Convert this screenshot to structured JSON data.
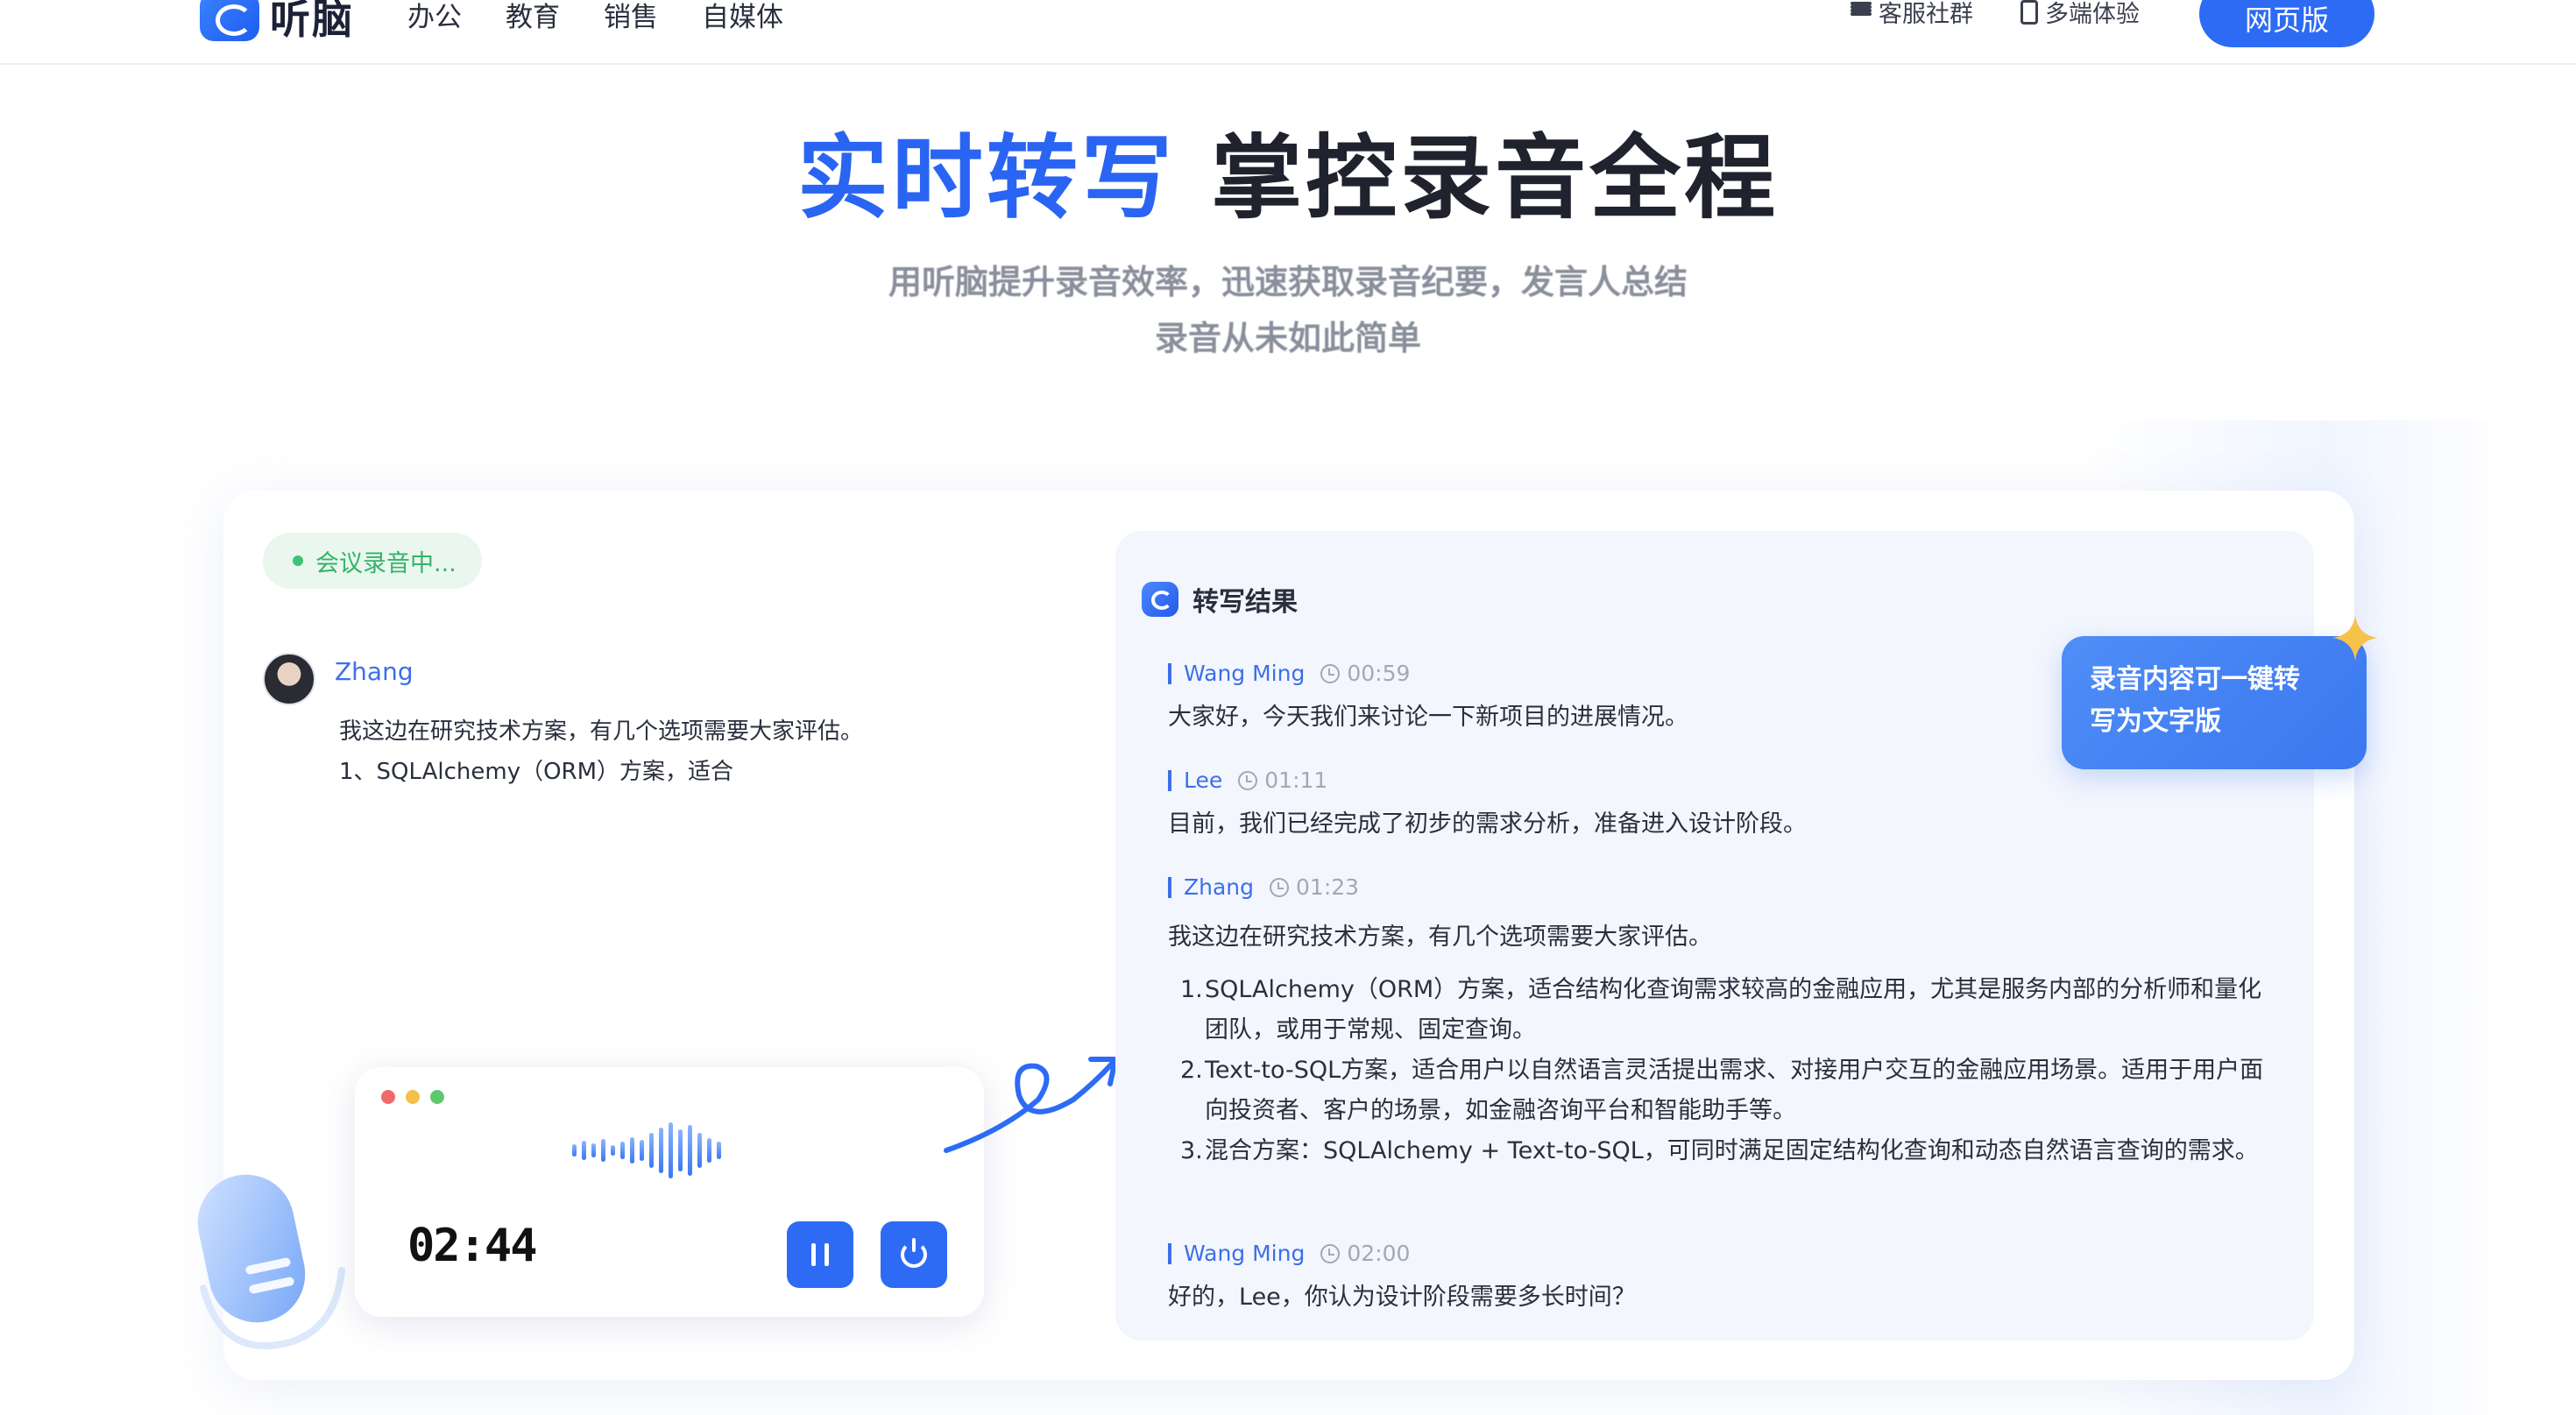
{
  "header": {
    "logo_text": "听脑",
    "nav": [
      "办公",
      "教育",
      "销售",
      "自媒体"
    ],
    "community_label": "客服社群",
    "multi_device_label": "多端体验",
    "web_button": "网页版"
  },
  "hero": {
    "title_blue": "实时转写",
    "title_dark": "掌控录音全程",
    "subtitle_line1": "用听脑提升录音效率，迅速获取录音纪要，发言人总结",
    "subtitle_line2": "录音从未如此简单"
  },
  "recording": {
    "badge": "会议录音中...",
    "speaker": "Zhang",
    "line1": "我这边在研究技术方案，有几个选项需要大家评估。",
    "line2": "1、SQLAlchemy（ORM）方案，适合",
    "timer": "02:44"
  },
  "transcript": {
    "title": "转写结果",
    "entries": [
      {
        "name": "Wang Ming",
        "time": "00:59",
        "text": "大家好，今天我们来讨论一下新项目的进展情况。"
      },
      {
        "name": "Lee",
        "time": "01:11",
        "text": "目前，我们已经完成了初步的需求分析，准备进入设计阶段。"
      },
      {
        "name": "Zhang",
        "time": "01:23",
        "text": "我这边在研究技术方案，有几个选项需要大家评估。"
      },
      {
        "name": "Wang Ming",
        "time": "02:00",
        "text": "好的，Lee，你认为设计阶段需要多长时间？"
      }
    ],
    "list": [
      {
        "num": "1.",
        "text": "SQLAlchemy（ORM）方案，适合结构化查询需求较高的金融应用，尤其是服务内部的分析师和量化团队，或用于常规、固定查询。"
      },
      {
        "num": "2.",
        "text": "Text-to-SQL方案，适合用户以自然语言灵活提出需求、对接用户交互的金融应用场景。适用于用户面向投资者、客户的场景，如金融咨询平台和智能助手等。"
      },
      {
        "num": "3.",
        "text": "混合方案：SQLAlchemy + Text-to-SQL，可同时满足固定结构化查询和动态自然语言查询的需求。"
      }
    ]
  },
  "callout": {
    "line1": "录音内容可一键转",
    "line2": "写为文字版"
  },
  "colors": {
    "brand_blue": "#2d6bf5",
    "title_blue": "#2a64f2",
    "speaker_blue": "#3d6fe8",
    "recording_green": "#34b36a",
    "panel_bg": "#f3f6fd"
  }
}
